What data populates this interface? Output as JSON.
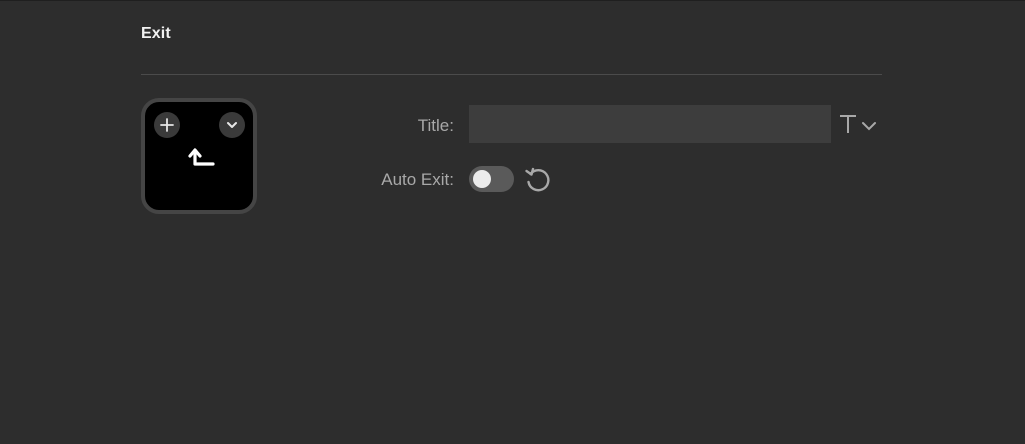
{
  "section": {
    "title": "Exit"
  },
  "tile": {
    "add_icon": "plus-icon",
    "menu_icon": "chevron-down-icon",
    "glyph_icon": "exit-arrow-icon"
  },
  "form": {
    "title_label": "Title:",
    "title_value": "",
    "title_placeholder": "",
    "font_icon": "text-style-icon",
    "auto_exit_label": "Auto Exit:",
    "auto_exit_enabled": false,
    "reset_icon": "reset-icon"
  },
  "colors": {
    "background": "#2d2d2d",
    "input_bg": "#3d3d3d",
    "tile_bg": "#000000",
    "label": "#a8a8a8"
  }
}
